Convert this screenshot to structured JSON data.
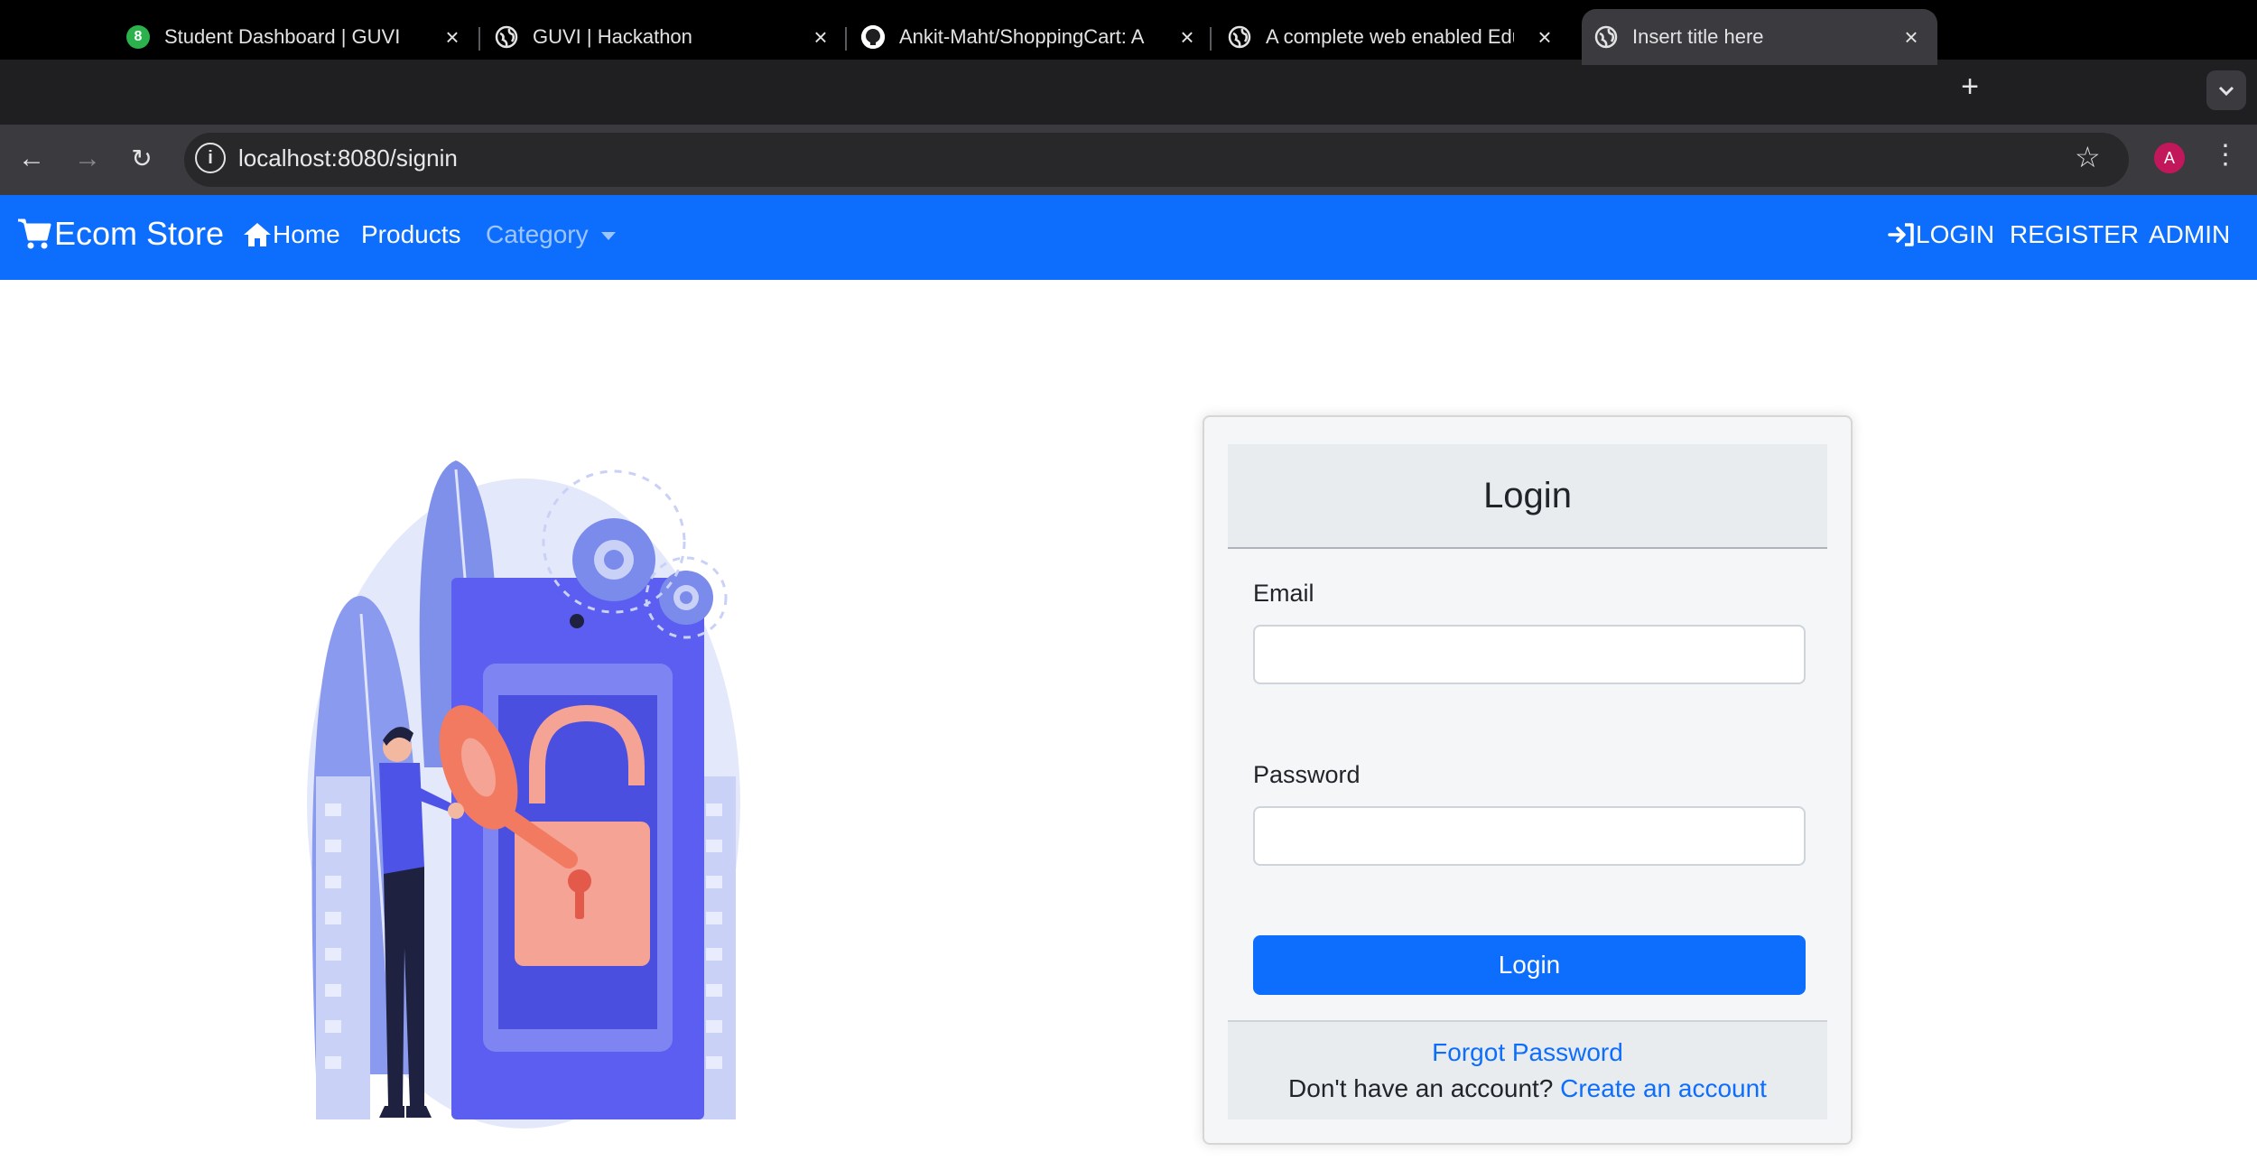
{
  "browser": {
    "tabs": [
      {
        "title": "Student Dashboard | GUVI",
        "icon": "guvi-icon",
        "active": false
      },
      {
        "title": "GUVI | Hackathon",
        "icon": "globe-icon",
        "active": false
      },
      {
        "title": "Ankit-Maht/ShoppingCart: An",
        "icon": "github-icon",
        "active": false
      },
      {
        "title": "A complete web enabled Edu",
        "icon": "globe-icon",
        "active": false
      },
      {
        "title": "Insert title here",
        "icon": "globe-icon",
        "active": true
      }
    ],
    "guvi_badge": "8",
    "close_glyph": "×",
    "new_tab_glyph": "+",
    "url": "localhost:8080/signin",
    "profile_initial": "A"
  },
  "navbar": {
    "brand": "Ecom Store",
    "home": "Home",
    "products": "Products",
    "category": "Category",
    "login": "LOGIN",
    "register": "REGISTER",
    "admin": "ADMIN",
    "bg_color": "#0d6efd"
  },
  "login_card": {
    "title": "Login",
    "email_label": "Email",
    "email_value": "",
    "password_label": "Password",
    "password_value": "",
    "submit_label": "Login",
    "forgot_link": "Forgot Password",
    "signup_prompt": "Don't have an account?",
    "signup_link": "Create an account"
  }
}
